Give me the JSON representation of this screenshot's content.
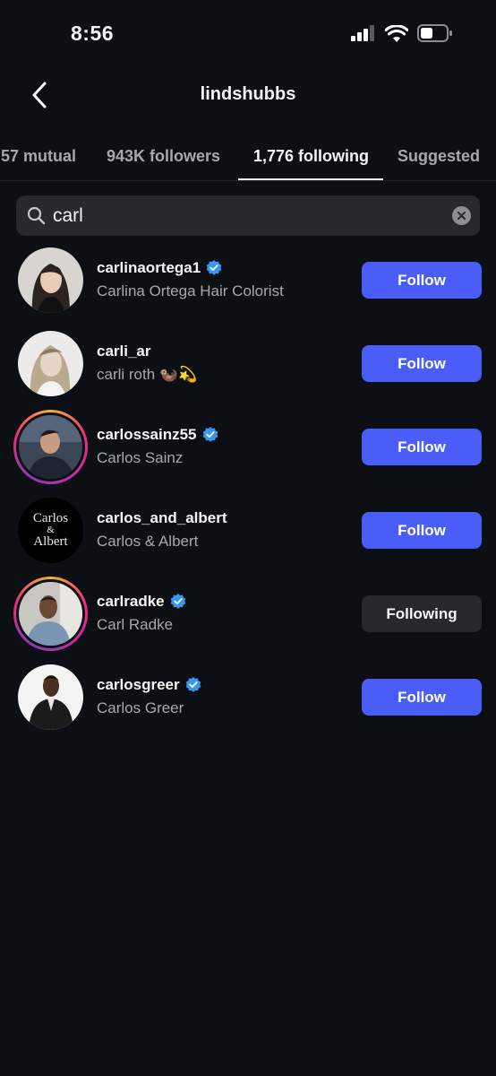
{
  "status": {
    "time": "8:56"
  },
  "header": {
    "title": "lindshubbs"
  },
  "tabs": [
    {
      "label": "57 mutual"
    },
    {
      "label": "943K followers"
    },
    {
      "label": "1,776 following"
    },
    {
      "label": "Suggested"
    }
  ],
  "search": {
    "value": "carl"
  },
  "accounts": [
    {
      "username": "carlinaortega1",
      "fullname": "Carlina Ortega Hair Colorist",
      "verified": true,
      "button": "Follow"
    },
    {
      "username": "carli_ar",
      "fullname": "carli roth 🦦💫",
      "verified": false,
      "button": "Follow"
    },
    {
      "username": "carlossainz55",
      "fullname": "Carlos Sainz",
      "verified": true,
      "button": "Follow"
    },
    {
      "username": "carlos_and_albert",
      "fullname": "Carlos & Albert",
      "verified": false,
      "button": "Follow",
      "avatar_text": [
        "Carlos",
        "&",
        "Albert"
      ]
    },
    {
      "username": "carlradke",
      "fullname": "Carl Radke",
      "verified": true,
      "button": "Following"
    },
    {
      "username": "carlosgreer",
      "fullname": "Carlos Greer",
      "verified": true,
      "button": "Follow"
    }
  ],
  "colors": {
    "background": "#0c1014",
    "follow_button": "#4a5df9",
    "following_button": "#25292e",
    "verified": "#3897f0"
  }
}
